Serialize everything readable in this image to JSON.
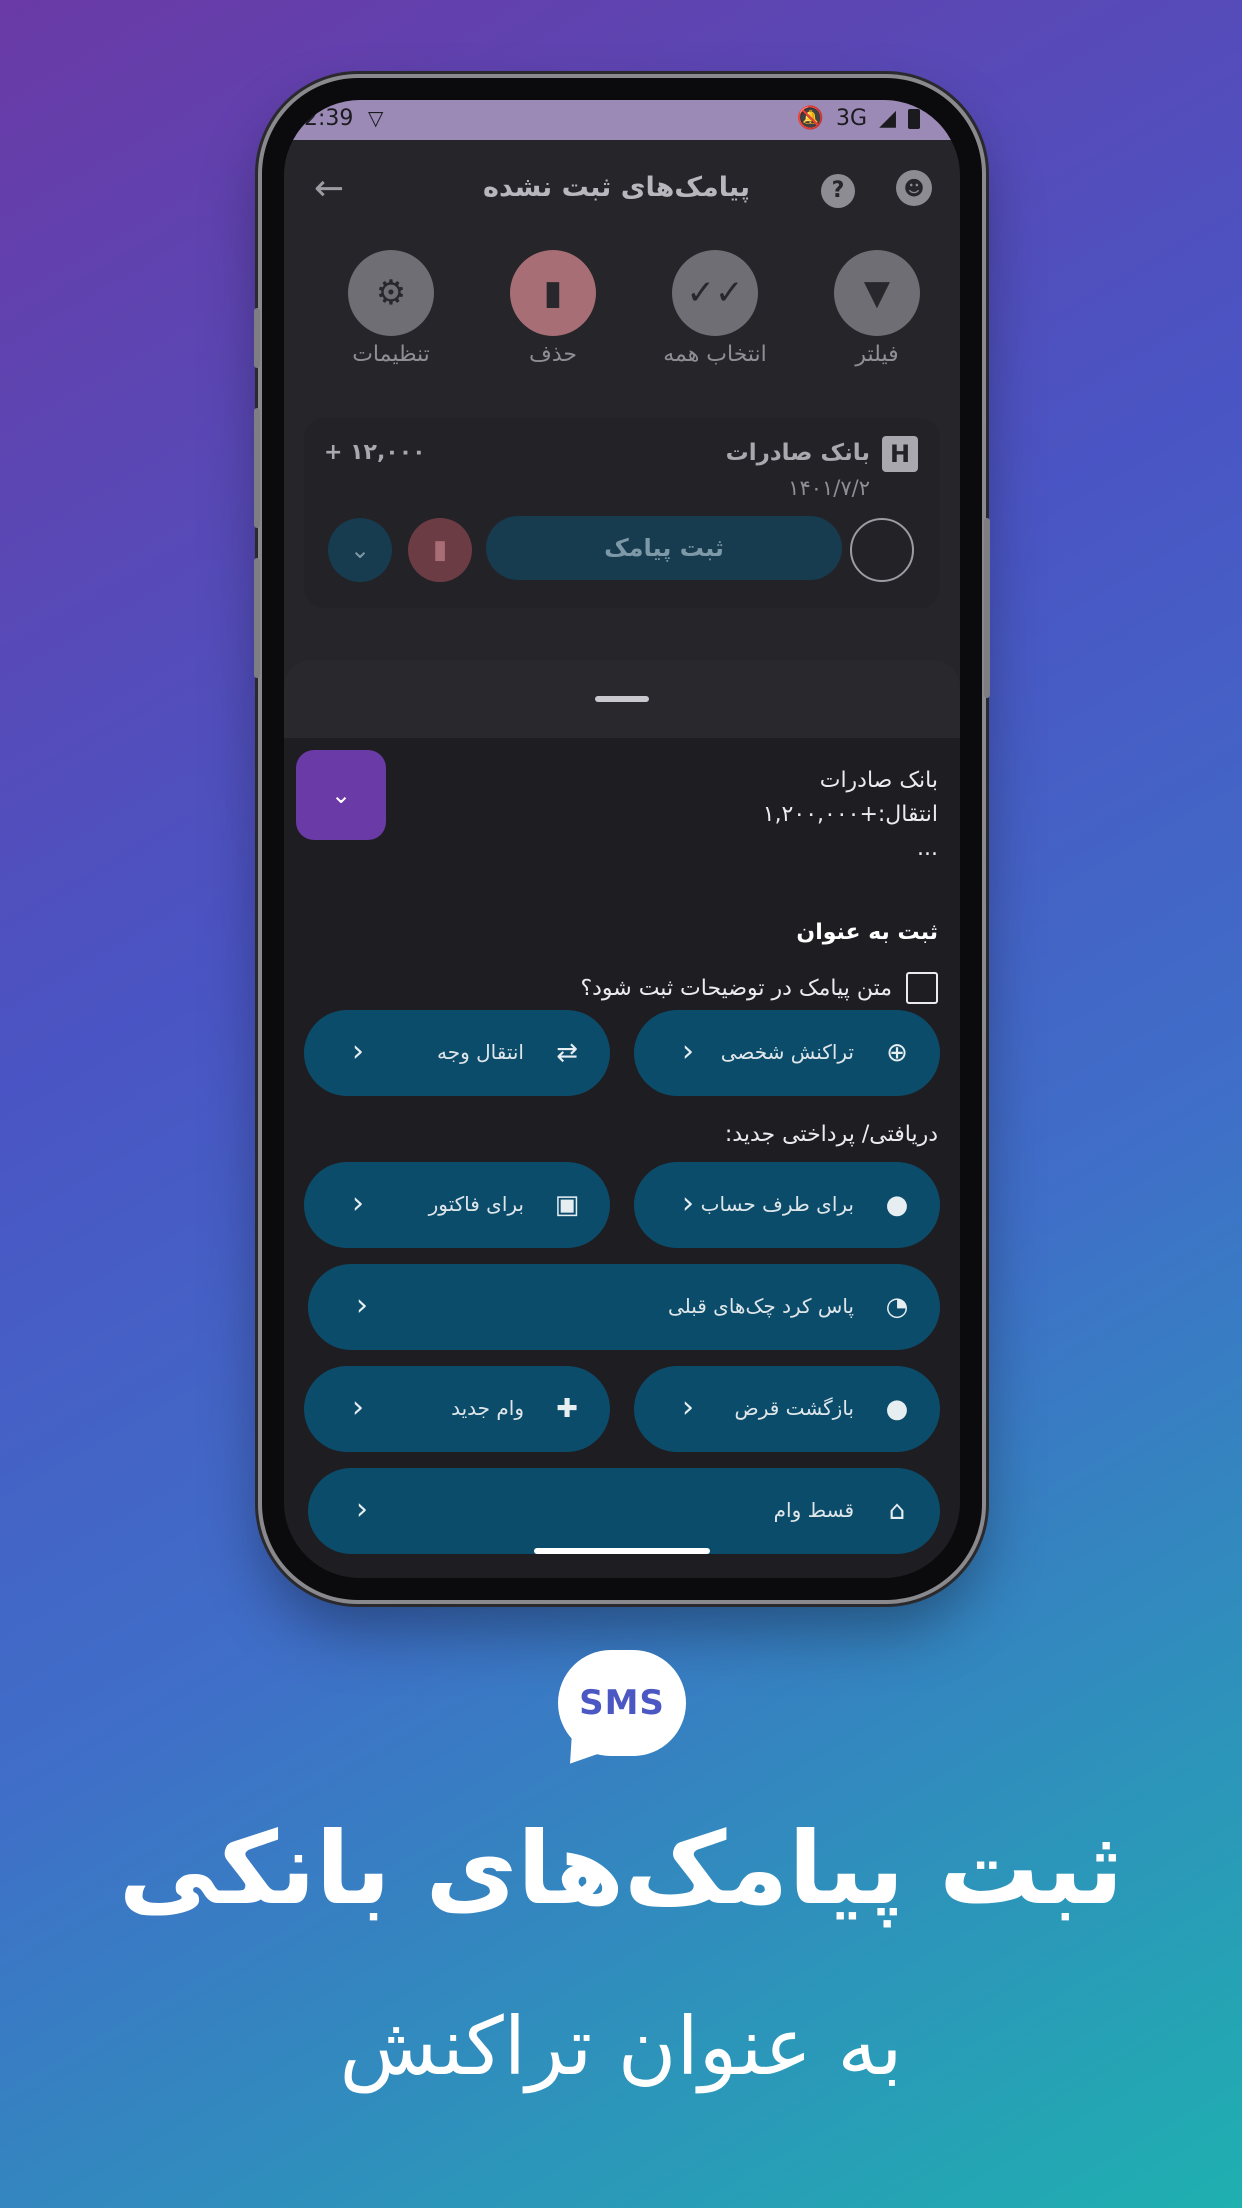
{
  "status_bar": {
    "time": "2:39",
    "network": "3G"
  },
  "app_bar": {
    "title": "پیامک‌های ثبت نشده"
  },
  "actions": [
    {
      "label": "فیلتر",
      "icon": "filter-icon"
    },
    {
      "label": "انتخاب همه",
      "icon": "double-check-icon"
    },
    {
      "label": "حذف",
      "icon": "trash-icon"
    },
    {
      "label": "تنظیمات",
      "icon": "gear-icon"
    }
  ],
  "sms_card": {
    "bank": "بانک صادرات",
    "date": "۱۴۰۱/۷/۲",
    "amount": "+ ۱۲,۰۰۰",
    "submit_label": "ثبت پیامک"
  },
  "sheet": {
    "preview_line1": "بانک صادرات",
    "preview_line2": "انتقال:+۱,۲۰۰,۰۰۰",
    "preview_line3": "...",
    "section_title": "ثبت به عنوان",
    "checkbox_label": "متن پیامک در توضیحات ثبت شود؟",
    "new_payment_label": "دریافتی/ پرداختی جدید:",
    "buttons": {
      "personal": "تراکنش شخصی",
      "transfer": "انتقال وجه",
      "account_party": "برای طرف حساب",
      "invoice": "برای فاکتور",
      "cheques": "پاس کرد چک‌های قبلی",
      "loan_return": "بازگشت قرض",
      "new_loan": "وام جدید",
      "installment": "قسط وام"
    }
  },
  "promo": {
    "badge": "SMS",
    "headline": "ثبت پیامک‌های بانکی",
    "subline": "به عنوان تراکنش"
  }
}
